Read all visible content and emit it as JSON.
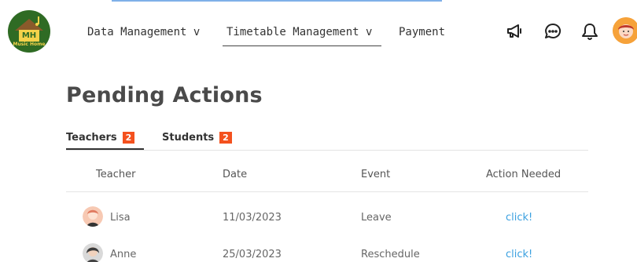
{
  "brand": {
    "logo_text": "MH",
    "logo_subtext": "Music Home",
    "colors": {
      "logo_bg": "#2f6b24",
      "logo_accent": "#f4d24a"
    }
  },
  "nav": {
    "items": [
      {
        "label": "Data Management v"
      },
      {
        "label": "Timetable Management v",
        "active": true
      },
      {
        "label": "Payment"
      }
    ]
  },
  "header_icons": [
    "megaphone-icon",
    "chat-icon",
    "bell-icon",
    "user-avatar"
  ],
  "page": {
    "title": "Pending Actions"
  },
  "tabs": [
    {
      "label": "Teachers",
      "count": "2",
      "active": true
    },
    {
      "label": "Students",
      "count": "2",
      "active": false
    }
  ],
  "table": {
    "columns": [
      "Teacher",
      "Date",
      "Event",
      "Action Needed"
    ],
    "rows": [
      {
        "teacher": "Lisa",
        "date": "11/03/2023",
        "event": "Leave",
        "action": "click!"
      },
      {
        "teacher": "Anne",
        "date": "25/03/2023",
        "event": "Reschedule",
        "action": "click!"
      }
    ]
  },
  "colors": {
    "badge": "#f4511e",
    "link": "#3aa0e0",
    "text": "#333333"
  }
}
